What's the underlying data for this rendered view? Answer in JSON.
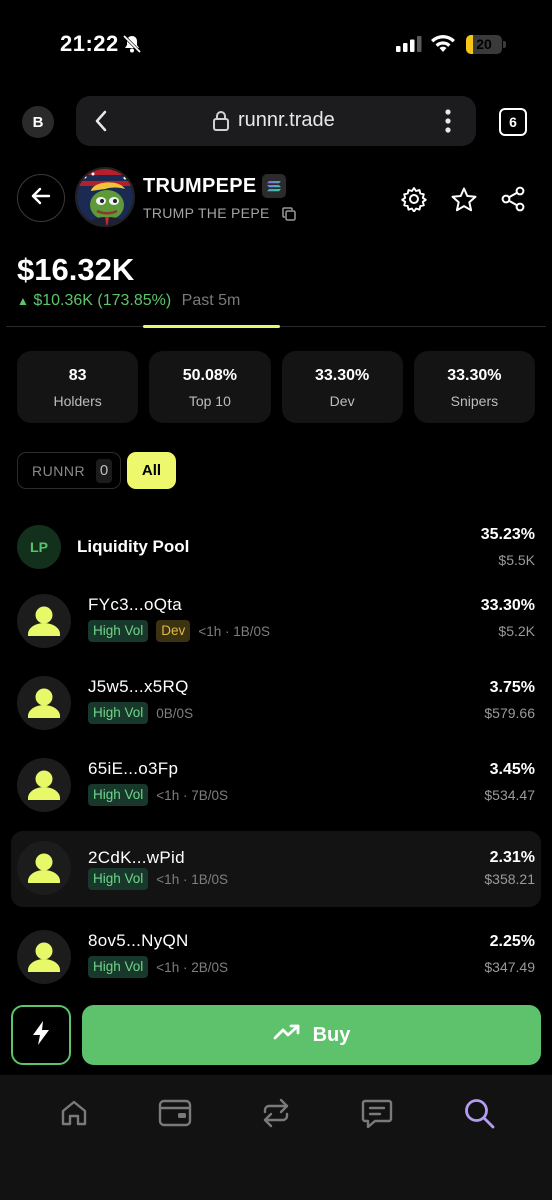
{
  "status_bar": {
    "time": "21:22",
    "battery": "20",
    "battery_level": 0.2,
    "icons": [
      "bell-slash-icon",
      "signal-icon",
      "wifi-icon",
      "battery-icon"
    ]
  },
  "browser": {
    "profile_initial": "B",
    "url": "runnr.trade",
    "tab_count": "6",
    "icons": [
      "chevron-left-icon",
      "lock-icon",
      "more-vertical-icon"
    ]
  },
  "token": {
    "symbol": "TRUMPEPE",
    "name": "TRUMP THE PEPE",
    "chain_icon": "solana-icon",
    "header_icons": [
      "arrow-left-icon",
      "gear-icon",
      "star-icon",
      "share-icon",
      "copy-icon"
    ]
  },
  "price": {
    "value": "$16.32K",
    "change_arrow": "▲",
    "change": "$10.36K (173.85%)",
    "period": "Past 5m",
    "accent_color": "#e9f76f",
    "up_color": "#5cc46a"
  },
  "stats": [
    {
      "value": "83",
      "label": "Holders"
    },
    {
      "value": "50.08%",
      "label": "Top 10"
    },
    {
      "value": "33.30%",
      "label": "Dev"
    },
    {
      "value": "33.30%",
      "label": "Snipers"
    }
  ],
  "filters": {
    "runnr_label": "RUNNR",
    "runnr_count": "0",
    "all_label": "All"
  },
  "liquidity_pool": {
    "badge": "LP",
    "name": "Liquidity Pool",
    "percent": "35.23%",
    "usd": "$5.5K"
  },
  "holders": [
    {
      "address": "FYc3...oQta",
      "tag": "High Vol",
      "dev_tag": "Dev",
      "meta": "<1h · 1B/0S",
      "percent": "33.30%",
      "usd": "$5.2K"
    },
    {
      "address": "J5w5...x5RQ",
      "tag": "High Vol",
      "meta": "0B/0S",
      "percent": "3.75%",
      "usd": "$579.66"
    },
    {
      "address": "65iE...o3Fp",
      "tag": "High Vol",
      "meta": "<1h · 7B/0S",
      "percent": "3.45%",
      "usd": "$534.47"
    },
    {
      "address": "2CdK...wPid",
      "tag": "High Vol",
      "meta": "<1h · 1B/0S",
      "percent": "2.31%",
      "usd": "$358.21"
    },
    {
      "address": "8ov5...NyQN",
      "tag": "High Vol",
      "meta": "<1h · 2B/0S",
      "percent": "2.25%",
      "usd": "$347.49"
    }
  ],
  "actions": {
    "quick_icon": "lightning-bolt-icon",
    "buy_label": "Buy",
    "buy_icon": "trending-up-icon",
    "buy_color": "#5ec26c"
  },
  "bottom_nav": [
    {
      "name": "home-icon"
    },
    {
      "name": "wallet-icon"
    },
    {
      "name": "swap-icon"
    },
    {
      "name": "chat-icon"
    },
    {
      "name": "search-icon",
      "active": true,
      "color": "#b59cf0"
    }
  ]
}
